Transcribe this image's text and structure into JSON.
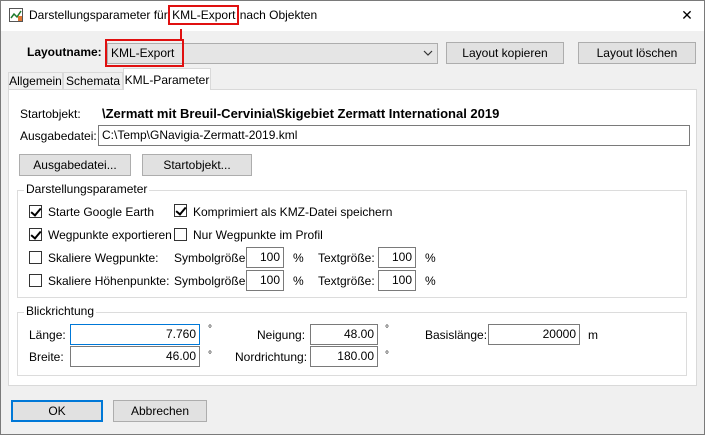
{
  "window": {
    "title_before": "Darstellungsparameter für ",
    "title_highlight": "KML-Export",
    "title_after": " nach Objekten",
    "close_glyph": "✕"
  },
  "layout": {
    "label": "Layoutname:",
    "value": "KML-Export",
    "copy_button": "Layout kopieren",
    "delete_button": "Layout löschen"
  },
  "tabs": [
    {
      "label": "Allgemein"
    },
    {
      "label": "Schemata"
    },
    {
      "label": "KML-Parameter"
    }
  ],
  "kml": {
    "start_label": "Startobjekt:",
    "start_value": "\\Zermatt mit Breuil-Cervinia\\Skigebiet Zermatt International 2019",
    "output_label": "Ausgabedatei:",
    "output_value": "C:\\Temp\\GNavigia-Zermatt-2019.kml",
    "output_button": "Ausgabedatei...",
    "start_button": "Startobjekt..."
  },
  "display": {
    "group_title": "Darstellungsparameter",
    "start_google_earth": {
      "label": "Starte Google Earth",
      "checked": true
    },
    "export_waypoints": {
      "label": "Wegpunkte exportieren",
      "checked": true
    },
    "scale_waypoints": {
      "label": "Skaliere Wegpunkte:",
      "checked": false
    },
    "scale_heightpoints": {
      "label": "Skaliere Höhenpunkte:",
      "checked": false
    },
    "compress_kmz": {
      "label": "Komprimiert als KMZ-Datei speichern",
      "checked": true
    },
    "only_profile_waypoints": {
      "label": "Nur Wegpunkte im Profil",
      "checked": false
    },
    "symbol_size_label": "Symbolgröße:",
    "text_size_label": "Textgröße:",
    "waypoint_symbol_size": "100",
    "waypoint_text_size": "100",
    "height_symbol_size": "100",
    "height_text_size": "100",
    "percent": "%"
  },
  "view": {
    "group_title": "Blickrichtung",
    "length_label": "Länge:",
    "length_value": "7.760",
    "width_label": "Breite:",
    "width_value": "46.00",
    "tilt_label": "Neigung:",
    "tilt_value": "48.00",
    "north_label": "Nordrichtung:",
    "north_value": "180.00",
    "base_label": "Basislänge:",
    "base_value": "20000",
    "degree": "°",
    "meter": "m"
  },
  "footer": {
    "ok": "OK",
    "cancel": "Abbrechen"
  },
  "colors": {
    "highlight": "#e01010",
    "focus": "#0078d7"
  }
}
